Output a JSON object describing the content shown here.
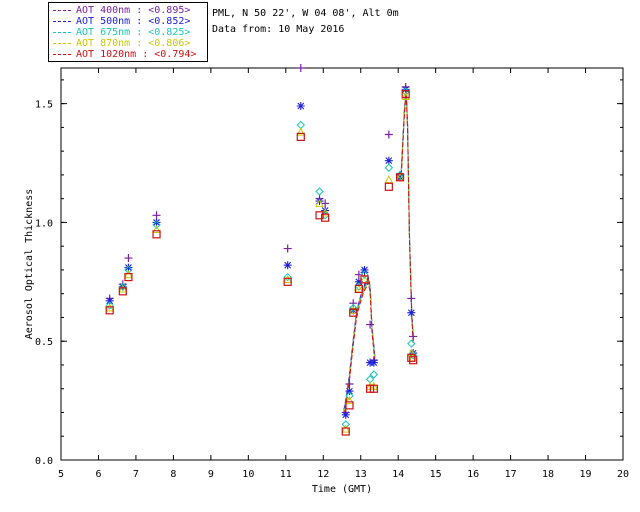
{
  "legend": [
    {
      "label": "AOT  400nm : <0.895>",
      "color": "#7a1fa2"
    },
    {
      "label": "AOT  500nm : <0.852>",
      "color": "#1d22d8"
    },
    {
      "label": "AOT  675nm : <0.825>",
      "color": "#16c8b4"
    },
    {
      "label": "AOT  870nm : <0.806>",
      "color": "#c8c800"
    },
    {
      "label": "AOT 1020nm : <0.794>",
      "color": "#cc1111"
    }
  ],
  "info": {
    "location": "PML, N 50 22', W 04 08', Alt 0m",
    "date": "Data from: 10 May 2016"
  },
  "chart_data": {
    "type": "scatter",
    "xlabel": "Time (GMT)",
    "ylabel": "Aerosol Optical Thickness",
    "xlim": [
      5,
      20
    ],
    "ylim": [
      0,
      1.65
    ],
    "xticks": [
      5,
      6,
      7,
      8,
      9,
      10,
      11,
      12,
      13,
      14,
      15,
      16,
      17,
      18,
      19,
      20
    ],
    "yticks": [
      0.0,
      0.5,
      1.0,
      1.5
    ],
    "ytick_labels": [
      "0.0",
      "0.5",
      "1.0",
      "1.5"
    ],
    "x": [
      6.3,
      6.65,
      6.8,
      7.55,
      11.05,
      11.4,
      11.9,
      12.05,
      12.6,
      12.7,
      12.8,
      12.95,
      13.1,
      13.25,
      13.35,
      13.75,
      14.05,
      14.2,
      14.35,
      14.4
    ],
    "series": [
      {
        "name": "AOT  400nm : <0.895>",
        "marker": "plus",
        "color": "#7a1fa2",
        "values": [
          0.68,
          0.74,
          0.85,
          1.03,
          0.89,
          1.65,
          1.1,
          1.08,
          0.2,
          0.32,
          0.66,
          0.78,
          0.79,
          0.57,
          0.42,
          1.37,
          1.2,
          1.57,
          0.68,
          0.52
        ]
      },
      {
        "name": "AOT  500nm : <0.852>",
        "marker": "star",
        "color": "#1d22d8",
        "values": [
          0.67,
          0.73,
          0.81,
          1.0,
          0.82,
          1.49,
          1.09,
          1.05,
          0.19,
          0.29,
          0.63,
          0.75,
          0.8,
          0.41,
          0.41,
          1.26,
          1.19,
          1.56,
          0.62,
          0.45
        ]
      },
      {
        "name": "AOT  675nm : <0.825>",
        "marker": "diamond",
        "color": "#16c8b4",
        "values": [
          0.65,
          0.73,
          0.8,
          0.99,
          0.77,
          1.41,
          1.13,
          1.03,
          0.15,
          0.27,
          0.64,
          0.73,
          0.78,
          0.34,
          0.36,
          1.23,
          1.2,
          1.55,
          0.49,
          0.44
        ]
      },
      {
        "name": "AOT  870nm : <0.806>",
        "marker": "triangle",
        "color": "#c8c800",
        "values": [
          0.64,
          0.72,
          0.78,
          0.97,
          0.76,
          1.38,
          1.08,
          1.04,
          0.13,
          0.25,
          0.63,
          0.72,
          0.76,
          0.31,
          0.31,
          1.18,
          1.19,
          1.53,
          0.45,
          0.43
        ]
      },
      {
        "name": "AOT 1020nm : <0.794>",
        "marker": "square",
        "color": "#cc1111",
        "values": [
          0.63,
          0.71,
          0.77,
          0.95,
          0.75,
          1.36,
          1.03,
          1.02,
          0.12,
          0.23,
          0.62,
          0.72,
          0.76,
          0.3,
          0.3,
          1.15,
          1.19,
          1.54,
          0.43,
          0.42
        ]
      }
    ],
    "curves": {
      "x": [
        12.55,
        12.62,
        12.7,
        12.78,
        12.88,
        12.93,
        13.0,
        13.08,
        13.15,
        13.2,
        13.25,
        13.3,
        13.38,
        13.98,
        14.08,
        14.16,
        14.21,
        14.25,
        14.3,
        14.36,
        14.4
      ],
      "y": [
        0.2,
        0.26,
        0.35,
        0.47,
        0.6,
        0.64,
        0.68,
        0.72,
        0.74,
        0.76,
        0.72,
        0.55,
        0.42,
        1.19,
        1.2,
        1.45,
        1.56,
        1.4,
        0.95,
        0.62,
        0.5
      ]
    }
  }
}
